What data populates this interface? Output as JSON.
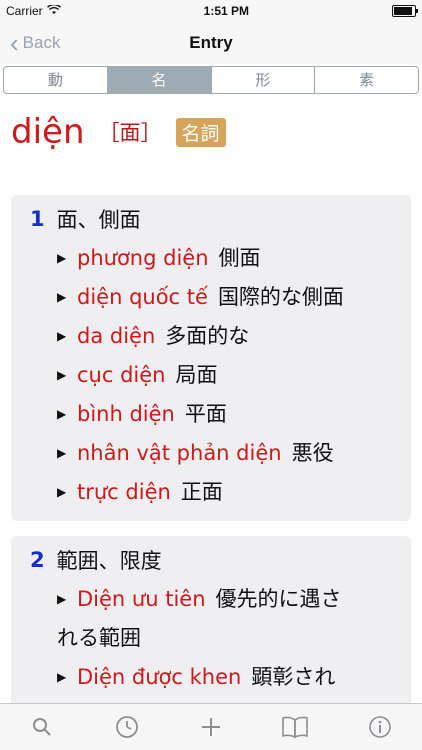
{
  "status": {
    "carrier": "Carrier",
    "time": "1:51 PM"
  },
  "nav": {
    "back_label": "Back",
    "title": "Entry"
  },
  "segments": [
    "動",
    "名",
    "形",
    "素"
  ],
  "active_segment": "名",
  "entry": {
    "headword": "diện",
    "kanji": "［面］",
    "pos": "名詞"
  },
  "senses": [
    {
      "num": "1",
      "gloss": "面、側面",
      "examples": [
        {
          "vi": "phương diện",
          "ja": "側面"
        },
        {
          "vi": "diện quốc tế",
          "ja": "国際的な側面"
        },
        {
          "vi": "da diện",
          "ja": "多面的な"
        },
        {
          "vi": "cục diện",
          "ja": "局面"
        },
        {
          "vi": "bình diện",
          "ja": "平面"
        },
        {
          "vi": "nhân vật phản diện",
          "ja": "悪役"
        },
        {
          "vi": "trực diện",
          "ja": "正面"
        }
      ]
    },
    {
      "num": "2",
      "gloss": "範囲、限度",
      "examples": [
        {
          "vi": "Diện ưu tiên",
          "ja": "優先的に遇さ",
          "ja2": "れる範囲"
        },
        {
          "vi": "Diện được khen",
          "ja": "顕彰され"
        }
      ]
    }
  ],
  "tabbar": [
    "search-icon",
    "history-icon",
    "add-icon",
    "bookmarks-icon",
    "info-icon"
  ],
  "colors": {
    "accent": "#d01818",
    "number": "#1530c8",
    "pos_badge": "#d6a45a",
    "segment": "#9eaab4"
  }
}
